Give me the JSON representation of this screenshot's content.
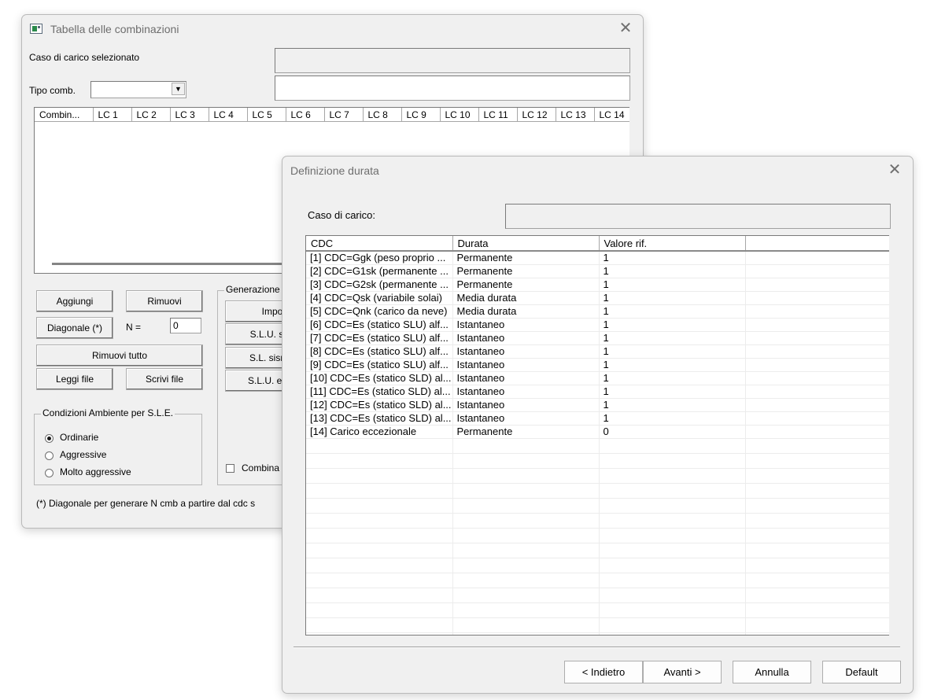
{
  "win1": {
    "title": "Tabella delle combinazioni",
    "case_label": "Caso di carico selezionato",
    "case_value": "",
    "tipo_label": "Tipo comb.",
    "tipo_value": "",
    "tipo_desc": "",
    "grid_headers": [
      "Combin...",
      "LC 1",
      "LC 2",
      "LC 3",
      "LC 4",
      "LC 5",
      "LC 6",
      "LC 7",
      "LC 8",
      "LC 9",
      "LC 10",
      "LC 11",
      "LC 12",
      "LC 13",
      "LC 14"
    ],
    "buttons": {
      "aggiungi": "Aggiungi",
      "rimuovi": "Rimuovi",
      "diagonale": "Diagonale (*)",
      "rimuovi_tutto": "Rimuovi tutto",
      "leggi_file": "Leggi file",
      "scrivi_file": "Scrivi file"
    },
    "n_label": "N =",
    "n_value": "0",
    "gen_group": {
      "title": "Generazione",
      "btn1": "Impo",
      "btn2": "S.L.U. stru",
      "btn3": "S.L. sismic",
      "btn4": "S.L.U. ecce",
      "check_label": "Combina"
    },
    "env_group": {
      "title": "Condizioni Ambiente per S.L.E.",
      "options": [
        "Ordinarie",
        "Aggressive",
        "Molto aggressive"
      ],
      "selected": "Ordinarie"
    },
    "footnote": "(*) Diagonale per generare N cmb a partire dal cdc s"
  },
  "win2": {
    "title": "Definizione durata",
    "case_label": "Caso di carico:",
    "case_value": "",
    "headers": [
      "CDC",
      "Durata",
      "Valore rif.",
      ""
    ],
    "rows": [
      [
        "[1] CDC=Ggk (peso proprio ...",
        "Permanente",
        "1"
      ],
      [
        "[2] CDC=G1sk (permanente ...",
        "Permanente",
        "1"
      ],
      [
        "[3] CDC=G2sk (permanente ...",
        "Permanente",
        "1"
      ],
      [
        "[4] CDC=Qsk (variabile solai)",
        "Media durata",
        "1"
      ],
      [
        "[5] CDC=Qnk (carico da neve)",
        "Media durata",
        "1"
      ],
      [
        "[6] CDC=Es (statico SLU)  alf...",
        "Istantaneo",
        "1"
      ],
      [
        "[7] CDC=Es (statico SLU)  alf...",
        "Istantaneo",
        "1"
      ],
      [
        "[8] CDC=Es (statico SLU)  alf...",
        "Istantaneo",
        "1"
      ],
      [
        "[9] CDC=Es (statico SLU)  alf...",
        "Istantaneo",
        "1"
      ],
      [
        "[10] CDC=Es (statico SLD) al...",
        "Istantaneo",
        "1"
      ],
      [
        "[11] CDC=Es (statico SLD) al...",
        "Istantaneo",
        "1"
      ],
      [
        "[12] CDC=Es (statico SLD) al...",
        "Istantaneo",
        "1"
      ],
      [
        "[13] CDC=Es (statico SLD) al...",
        "Istantaneo",
        "1"
      ],
      [
        "[14] Carico eccezionale",
        "Permanente",
        "0"
      ]
    ],
    "buttons": {
      "indietro": "< Indietro",
      "avanti": "Avanti >",
      "annulla": "Annulla",
      "default": "Default"
    }
  }
}
